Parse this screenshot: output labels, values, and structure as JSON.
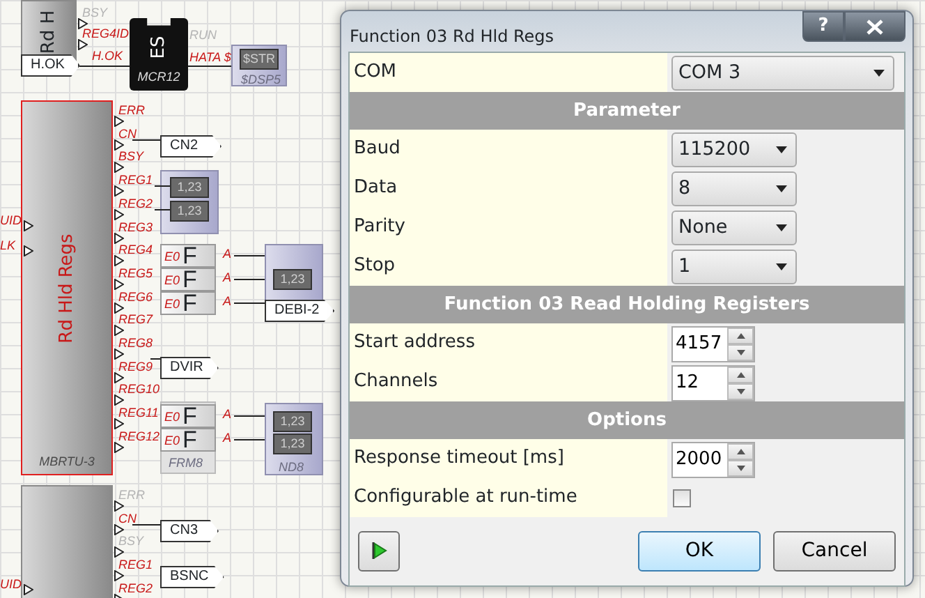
{
  "diagram": {
    "modules": [
      {
        "title": "Rd H",
        "pins": [
          {
            "label": "BSY",
            "active": false
          },
          {
            "label": "REG4ID",
            "active": true
          }
        ]
      },
      {
        "title": "Rd Hld Regs",
        "footer": "MBRTU-3",
        "pins": [
          {
            "label": "ERR",
            "active": true
          },
          {
            "label": "CN",
            "active": true
          },
          {
            "label": "BSY",
            "active": true
          },
          {
            "label": "REG1",
            "active": true
          },
          {
            "label": "REG2",
            "active": true
          },
          {
            "label": "REG3",
            "active": true
          },
          {
            "label": "REG4",
            "active": true
          },
          {
            "label": "REG5",
            "active": true
          },
          {
            "label": "REG6",
            "active": true
          },
          {
            "label": "REG7",
            "active": true
          },
          {
            "label": "REG8",
            "active": true
          },
          {
            "label": "REG9",
            "active": true
          },
          {
            "label": "REG10",
            "active": true
          },
          {
            "label": "REG11",
            "active": true
          },
          {
            "label": "REG12",
            "active": true
          }
        ]
      },
      {
        "pins": [
          {
            "label": "ERR",
            "active": false
          },
          {
            "label": "CN",
            "active": true
          },
          {
            "label": "BSY",
            "active": false
          },
          {
            "label": "REG1",
            "active": true
          },
          {
            "label": "REG2",
            "active": true
          }
        ]
      }
    ],
    "inputs": [
      "UID",
      "LK",
      "UID"
    ],
    "tags": [
      "H.OK",
      "CN2",
      "DEBI-2",
      "DVIR",
      "CN3",
      "BSNC"
    ],
    "converter": {
      "title": "ES",
      "footer": "MCR12",
      "input": "H.OK",
      "outputs": [
        {
          "label": "RUN",
          "active": false
        },
        {
          "label": "HATA $",
          "active": true
        }
      ]
    },
    "string_display": {
      "value": "$STR",
      "footer": "$DSP5"
    },
    "displays": [
      {
        "value": "1,23"
      },
      {
        "value": "1,23"
      },
      {
        "value": "1,23"
      },
      {
        "value": "1,23"
      },
      {
        "value": "1,23"
      }
    ],
    "display_footer": "ND8",
    "formulas": [
      {
        "symbol": "F",
        "input": "E0",
        "output": "A"
      },
      {
        "symbol": "F",
        "input": "E0",
        "output": "A"
      },
      {
        "symbol": "F",
        "input": "E0",
        "output": "A"
      },
      {
        "symbol": "F",
        "input": "E0",
        "output": "A"
      },
      {
        "symbol": "F",
        "input": "E0",
        "output": "A"
      }
    ],
    "formula_footer": "FRM8"
  },
  "dialog": {
    "title": "Function 03 Rd Hld Regs",
    "help_button": "?",
    "rows": [
      {
        "kind": "combo",
        "label": "COM",
        "value": "COM 3"
      },
      {
        "kind": "header",
        "label": "Parameter"
      },
      {
        "kind": "combo",
        "label": "Baud",
        "value": "115200"
      },
      {
        "kind": "combo",
        "label": "Data",
        "value": "8"
      },
      {
        "kind": "combo",
        "label": "Parity",
        "value": "None"
      },
      {
        "kind": "combo",
        "label": "Stop",
        "value": "1"
      },
      {
        "kind": "header",
        "label": "Function 03 Read Holding Registers"
      },
      {
        "kind": "spin",
        "label": "Start address",
        "value": "4157"
      },
      {
        "kind": "spin",
        "label": "Channels",
        "value": "12"
      },
      {
        "kind": "header",
        "label": "Options"
      },
      {
        "kind": "spin",
        "label": "Response timeout [ms]",
        "value": "2000"
      },
      {
        "kind": "checkbox",
        "label": "Configurable at run-time",
        "checked": false
      }
    ],
    "buttons": [
      {
        "label": "OK",
        "default": true
      },
      {
        "label": "Cancel",
        "default": false
      }
    ]
  }
}
